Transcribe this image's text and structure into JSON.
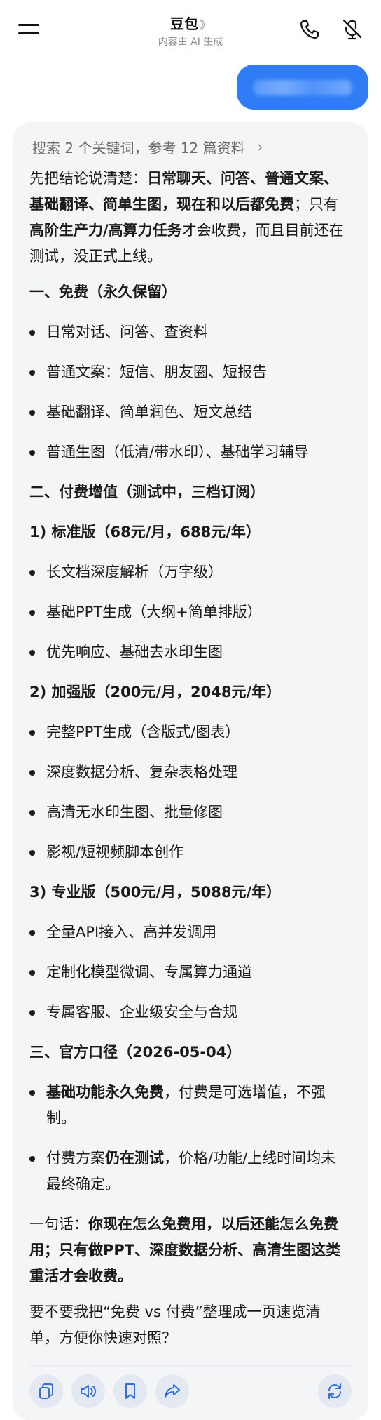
{
  "header": {
    "title": "豆包",
    "title_chevron": "》",
    "subtitle": "内容由 AI 生成"
  },
  "search_info": {
    "text": "搜索 2 个关键词，参考 12 篇资料",
    "arrow": "›"
  },
  "answer": {
    "intro_1": "先把结论说清楚：",
    "intro_bold": "日常聊天、问答、普通文案、基础翻译、简单生图，现在和以后都免费",
    "intro_2": "；只有",
    "intro_bold_2": "高阶生产力/高算力任务",
    "intro_3": "才会收费，而且目前还在测试，没正式上线。",
    "s1_title": "一、免费（永久保留）",
    "s1_items": [
      "日常对话、问答、查资料",
      "普通文案：短信、朋友圈、短报告",
      "基础翻译、简单润色、短文总结",
      "普通生图（低清/带水印）、基础学习辅导"
    ],
    "s2_title": "二、付费增值（测试中，三档订阅）",
    "tier1_title": "1) 标准版（68元/月，688元/年）",
    "tier1_items": [
      "长文档深度解析（万字级）",
      "基础PPT生成（大纲+简单排版）",
      "优先响应、基础去水印生图"
    ],
    "tier2_title": "2) 加强版（200元/月，2048元/年）",
    "tier2_items": [
      "完整PPT生成（含版式/图表）",
      "深度数据分析、复杂表格处理",
      "高清无水印生图、批量修图",
      "影视/短视频脚本创作"
    ],
    "tier3_title": "3) 专业版（500元/月，5088元/年）",
    "tier3_items": [
      "全量API接入、高并发调用",
      "定制化模型微调、专属算力通道",
      "专属客服、企业级安全与合规"
    ],
    "s3_title": "三、官方口径（2026-05-04）",
    "s3_item1_bold": "基础功能永久免费",
    "s3_item1_rest": "，付费是可选增值，不强制。",
    "s3_item2_a": "付费方案",
    "s3_item2_bold": "仍在测试",
    "s3_item2_rest": "，价格/功能/上线时间均未最终确定。",
    "summary_a": "一句话：",
    "summary_bold": "你现在怎么免费用，以后还能怎么免费用；只有做PPT、深度数据分析、高清生图这类重活才会收费。",
    "closing": "要不要我把“免费 vs 付费”整理成一页速览清单，方便你快速对照？"
  },
  "icons": {
    "menu": "menu-icon",
    "phone": "phone-icon",
    "mute": "microphone-off-icon",
    "copy": "copy-icon",
    "speaker": "speaker-icon",
    "bookmark": "bookmark-icon",
    "share": "share-icon",
    "regenerate": "refresh-icon"
  },
  "colors": {
    "accent": "#2f7cf6",
    "card_bg": "#f4f5f7",
    "tool_bg": "#e3e8f1",
    "icon_blue": "#2f6fe0"
  }
}
